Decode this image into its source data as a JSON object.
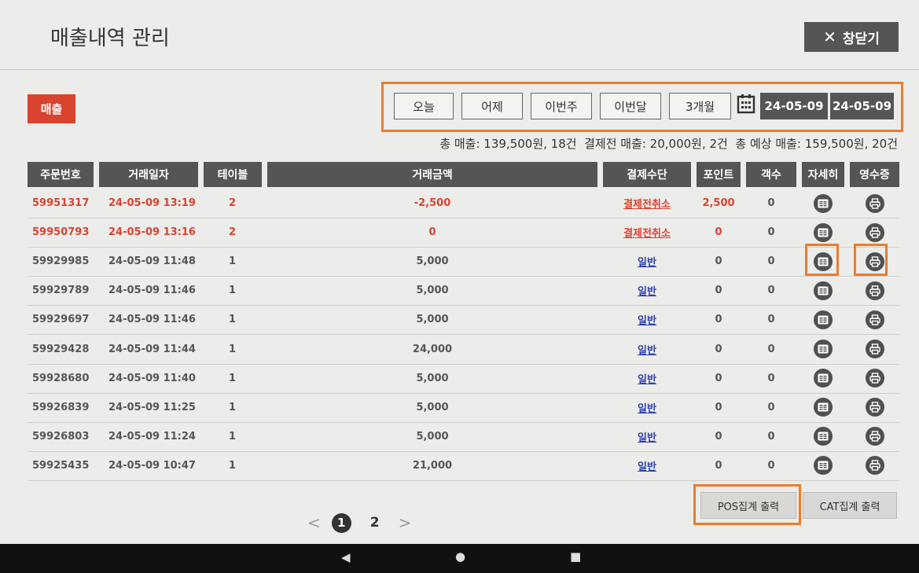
{
  "header": {
    "title": "매출내역 관리",
    "close_label": "창닫기"
  },
  "badge": "매출",
  "filters": {
    "today": "오늘",
    "yesterday": "어제",
    "this_week": "이번주",
    "this_month": "이번달",
    "three_months": "3개월",
    "date_from": "24-05-09",
    "date_to": "24-05-09"
  },
  "summary": "총 매출: 139,500원, 18건  결제전 매출: 20,000원, 2건  총 예상 매출: 159,500원, 20건",
  "columns": {
    "order_no": "주문번호",
    "date": "거래일자",
    "table": "테이블",
    "amount": "거래금액",
    "method": "결제수단",
    "point": "포인트",
    "guests": "객수",
    "detail": "자세히",
    "receipt": "영수증"
  },
  "rows": [
    {
      "order": "59951317",
      "date": "24-05-09 13:19",
      "table": "2",
      "amount": "-2,500",
      "method": "결제전취소",
      "point": "2,500",
      "guests": "0",
      "cancel": true
    },
    {
      "order": "59950793",
      "date": "24-05-09 13:16",
      "table": "2",
      "amount": "0",
      "method": "결제전취소",
      "point": "0",
      "guests": "0",
      "cancel": true
    },
    {
      "order": "59929985",
      "date": "24-05-09 11:48",
      "table": "1",
      "amount": "5,000",
      "method": "일반",
      "point": "0",
      "guests": "0",
      "cancel": false
    },
    {
      "order": "59929789",
      "date": "24-05-09 11:46",
      "table": "1",
      "amount": "5,000",
      "method": "일반",
      "point": "0",
      "guests": "0",
      "cancel": false
    },
    {
      "order": "59929697",
      "date": "24-05-09 11:46",
      "table": "1",
      "amount": "5,000",
      "method": "일반",
      "point": "0",
      "guests": "0",
      "cancel": false
    },
    {
      "order": "59929428",
      "date": "24-05-09 11:44",
      "table": "1",
      "amount": "24,000",
      "method": "일반",
      "point": "0",
      "guests": "0",
      "cancel": false
    },
    {
      "order": "59928680",
      "date": "24-05-09 11:40",
      "table": "1",
      "amount": "5,000",
      "method": "일반",
      "point": "0",
      "guests": "0",
      "cancel": false
    },
    {
      "order": "59926839",
      "date": "24-05-09 11:25",
      "table": "1",
      "amount": "5,000",
      "method": "일반",
      "point": "0",
      "guests": "0",
      "cancel": false
    },
    {
      "order": "59926803",
      "date": "24-05-09 11:24",
      "table": "1",
      "amount": "5,000",
      "method": "일반",
      "point": "0",
      "guests": "0",
      "cancel": false
    },
    {
      "order": "59925435",
      "date": "24-05-09 10:47",
      "table": "1",
      "amount": "21,000",
      "method": "일반",
      "point": "0",
      "guests": "0",
      "cancel": false
    }
  ],
  "pagination": {
    "prev": "<",
    "current": "1",
    "next_page": "2",
    "next": ">"
  },
  "footer": {
    "pos_print": "POS집계 출력",
    "cat_print": "CAT집계 출력"
  },
  "navbar": {
    "back": "◀",
    "home": "●",
    "recents": "■"
  },
  "colors": {
    "accent": "#d9432f",
    "highlight": "#ec7c2a",
    "dark": "#555555",
    "link": "#2c3fa8"
  }
}
